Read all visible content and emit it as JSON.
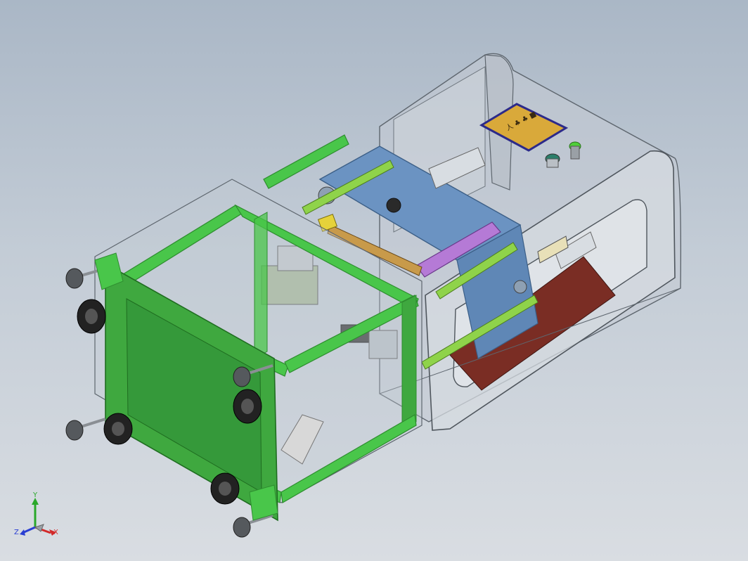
{
  "viewport": {
    "background_top": "#aab7c6",
    "background_bottom": "#d9dde2"
  },
  "model": {
    "colors": {
      "frame_green": "#49c64a",
      "frame_green_dark": "#2e8d2f",
      "panel_green": "#3fa83f",
      "steel_plate": "#6b93c2",
      "steel_plate_dark": "#4d739f",
      "housing_outline": "#6e767e",
      "housing_fill": "#c9cfd5",
      "shaft_green": "#8fd34a",
      "purple_bar": "#b57ad6",
      "yellow_block": "#e5d23a",
      "brown_base": "#7a2d24",
      "label_gold": "#d9a93a",
      "label_border": "#2c2a8a",
      "caster_black": "#222222",
      "foot_gray": "#8a8f94"
    },
    "control_panel": {
      "plate_text": "人 ♣ ♣ ■",
      "indicator_color": "#4fcf3a"
    }
  },
  "triad": {
    "x_label": "X",
    "y_label": "Y",
    "z_label": "Z",
    "x_color": "#d22a2a",
    "y_color": "#2aa82a",
    "z_color": "#2a3fd2"
  }
}
